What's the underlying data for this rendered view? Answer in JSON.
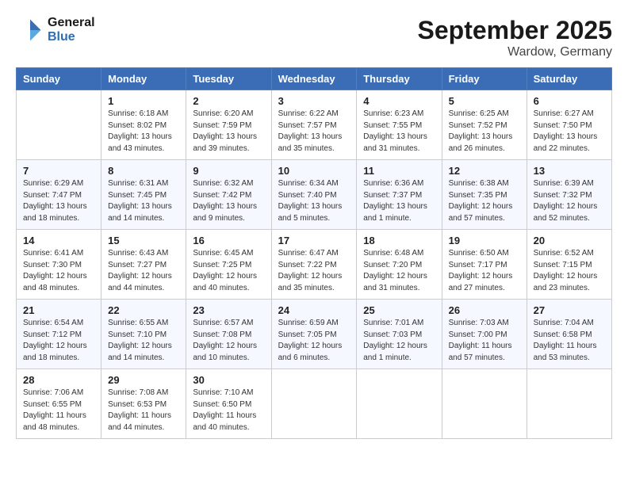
{
  "header": {
    "logo": {
      "line1": "General",
      "line2": "Blue"
    },
    "title": "September 2025",
    "location": "Wardow, Germany"
  },
  "weekdays": [
    "Sunday",
    "Monday",
    "Tuesday",
    "Wednesday",
    "Thursday",
    "Friday",
    "Saturday"
  ],
  "weeks": [
    [
      {
        "day": "",
        "sunrise": "",
        "sunset": "",
        "daylight": ""
      },
      {
        "day": "1",
        "sunrise": "Sunrise: 6:18 AM",
        "sunset": "Sunset: 8:02 PM",
        "daylight": "Daylight: 13 hours and 43 minutes."
      },
      {
        "day": "2",
        "sunrise": "Sunrise: 6:20 AM",
        "sunset": "Sunset: 7:59 PM",
        "daylight": "Daylight: 13 hours and 39 minutes."
      },
      {
        "day": "3",
        "sunrise": "Sunrise: 6:22 AM",
        "sunset": "Sunset: 7:57 PM",
        "daylight": "Daylight: 13 hours and 35 minutes."
      },
      {
        "day": "4",
        "sunrise": "Sunrise: 6:23 AM",
        "sunset": "Sunset: 7:55 PM",
        "daylight": "Daylight: 13 hours and 31 minutes."
      },
      {
        "day": "5",
        "sunrise": "Sunrise: 6:25 AM",
        "sunset": "Sunset: 7:52 PM",
        "daylight": "Daylight: 13 hours and 26 minutes."
      },
      {
        "day": "6",
        "sunrise": "Sunrise: 6:27 AM",
        "sunset": "Sunset: 7:50 PM",
        "daylight": "Daylight: 13 hours and 22 minutes."
      }
    ],
    [
      {
        "day": "7",
        "sunrise": "Sunrise: 6:29 AM",
        "sunset": "Sunset: 7:47 PM",
        "daylight": "Daylight: 13 hours and 18 minutes."
      },
      {
        "day": "8",
        "sunrise": "Sunrise: 6:31 AM",
        "sunset": "Sunset: 7:45 PM",
        "daylight": "Daylight: 13 hours and 14 minutes."
      },
      {
        "day": "9",
        "sunrise": "Sunrise: 6:32 AM",
        "sunset": "Sunset: 7:42 PM",
        "daylight": "Daylight: 13 hours and 9 minutes."
      },
      {
        "day": "10",
        "sunrise": "Sunrise: 6:34 AM",
        "sunset": "Sunset: 7:40 PM",
        "daylight": "Daylight: 13 hours and 5 minutes."
      },
      {
        "day": "11",
        "sunrise": "Sunrise: 6:36 AM",
        "sunset": "Sunset: 7:37 PM",
        "daylight": "Daylight: 13 hours and 1 minute."
      },
      {
        "day": "12",
        "sunrise": "Sunrise: 6:38 AM",
        "sunset": "Sunset: 7:35 PM",
        "daylight": "Daylight: 12 hours and 57 minutes."
      },
      {
        "day": "13",
        "sunrise": "Sunrise: 6:39 AM",
        "sunset": "Sunset: 7:32 PM",
        "daylight": "Daylight: 12 hours and 52 minutes."
      }
    ],
    [
      {
        "day": "14",
        "sunrise": "Sunrise: 6:41 AM",
        "sunset": "Sunset: 7:30 PM",
        "daylight": "Daylight: 12 hours and 48 minutes."
      },
      {
        "day": "15",
        "sunrise": "Sunrise: 6:43 AM",
        "sunset": "Sunset: 7:27 PM",
        "daylight": "Daylight: 12 hours and 44 minutes."
      },
      {
        "day": "16",
        "sunrise": "Sunrise: 6:45 AM",
        "sunset": "Sunset: 7:25 PM",
        "daylight": "Daylight: 12 hours and 40 minutes."
      },
      {
        "day": "17",
        "sunrise": "Sunrise: 6:47 AM",
        "sunset": "Sunset: 7:22 PM",
        "daylight": "Daylight: 12 hours and 35 minutes."
      },
      {
        "day": "18",
        "sunrise": "Sunrise: 6:48 AM",
        "sunset": "Sunset: 7:20 PM",
        "daylight": "Daylight: 12 hours and 31 minutes."
      },
      {
        "day": "19",
        "sunrise": "Sunrise: 6:50 AM",
        "sunset": "Sunset: 7:17 PM",
        "daylight": "Daylight: 12 hours and 27 minutes."
      },
      {
        "day": "20",
        "sunrise": "Sunrise: 6:52 AM",
        "sunset": "Sunset: 7:15 PM",
        "daylight": "Daylight: 12 hours and 23 minutes."
      }
    ],
    [
      {
        "day": "21",
        "sunrise": "Sunrise: 6:54 AM",
        "sunset": "Sunset: 7:12 PM",
        "daylight": "Daylight: 12 hours and 18 minutes."
      },
      {
        "day": "22",
        "sunrise": "Sunrise: 6:55 AM",
        "sunset": "Sunset: 7:10 PM",
        "daylight": "Daylight: 12 hours and 14 minutes."
      },
      {
        "day": "23",
        "sunrise": "Sunrise: 6:57 AM",
        "sunset": "Sunset: 7:08 PM",
        "daylight": "Daylight: 12 hours and 10 minutes."
      },
      {
        "day": "24",
        "sunrise": "Sunrise: 6:59 AM",
        "sunset": "Sunset: 7:05 PM",
        "daylight": "Daylight: 12 hours and 6 minutes."
      },
      {
        "day": "25",
        "sunrise": "Sunrise: 7:01 AM",
        "sunset": "Sunset: 7:03 PM",
        "daylight": "Daylight: 12 hours and 1 minute."
      },
      {
        "day": "26",
        "sunrise": "Sunrise: 7:03 AM",
        "sunset": "Sunset: 7:00 PM",
        "daylight": "Daylight: 11 hours and 57 minutes."
      },
      {
        "day": "27",
        "sunrise": "Sunrise: 7:04 AM",
        "sunset": "Sunset: 6:58 PM",
        "daylight": "Daylight: 11 hours and 53 minutes."
      }
    ],
    [
      {
        "day": "28",
        "sunrise": "Sunrise: 7:06 AM",
        "sunset": "Sunset: 6:55 PM",
        "daylight": "Daylight: 11 hours and 48 minutes."
      },
      {
        "day": "29",
        "sunrise": "Sunrise: 7:08 AM",
        "sunset": "Sunset: 6:53 PM",
        "daylight": "Daylight: 11 hours and 44 minutes."
      },
      {
        "day": "30",
        "sunrise": "Sunrise: 7:10 AM",
        "sunset": "Sunset: 6:50 PM",
        "daylight": "Daylight: 11 hours and 40 minutes."
      },
      {
        "day": "",
        "sunrise": "",
        "sunset": "",
        "daylight": ""
      },
      {
        "day": "",
        "sunrise": "",
        "sunset": "",
        "daylight": ""
      },
      {
        "day": "",
        "sunrise": "",
        "sunset": "",
        "daylight": ""
      },
      {
        "day": "",
        "sunrise": "",
        "sunset": "",
        "daylight": ""
      }
    ]
  ]
}
